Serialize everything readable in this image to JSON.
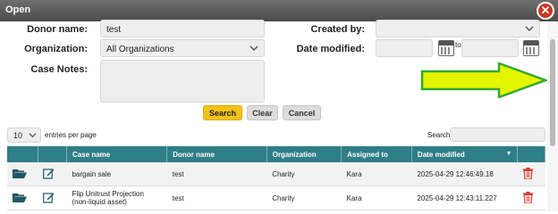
{
  "window": {
    "title": "Open",
    "close_symbol": "✕"
  },
  "form": {
    "donor_name_label": "Donor name:",
    "donor_name_value": "test",
    "organization_label": "Organization:",
    "organization_value": "All Organizations",
    "case_notes_label": "Case Notes:",
    "created_by_label": "Created by:",
    "date_modified_label": "Date modified:",
    "date_to_label": "to"
  },
  "buttons": {
    "search": "Search",
    "clear": "Clear",
    "cancel": "Cancel"
  },
  "list_controls": {
    "entries_value": "10",
    "entries_label": "entries per page",
    "search_label": "Search:"
  },
  "table": {
    "columns": [
      "Case name",
      "Donor name",
      "Organization",
      "Assigned to",
      "Date modified"
    ],
    "sort_indicator": "▼",
    "rows": [
      {
        "case_name": "bargain sale",
        "donor_name": "test",
        "organization": "Charity",
        "assigned_to": "Kara",
        "date_modified": "2025-04-29 12:46:49.18"
      },
      {
        "case_name": "Flip Unitrust Projection (non-liquid asset)",
        "donor_name": "test",
        "organization": "Charity",
        "assigned_to": "Kara",
        "date_modified": "2025-04-29 12:43:11.227"
      }
    ]
  },
  "colors": {
    "header_teal": "#2f7e88",
    "accent_yellow": "#f3c417",
    "close_red": "#c9361f",
    "annotation_arrow": "#e5f400"
  },
  "icons": [
    "close-icon",
    "chevron-down-icon",
    "calendar-icon",
    "folder-open-icon",
    "edit-icon",
    "trash-icon",
    "arrow-right-icon"
  ]
}
